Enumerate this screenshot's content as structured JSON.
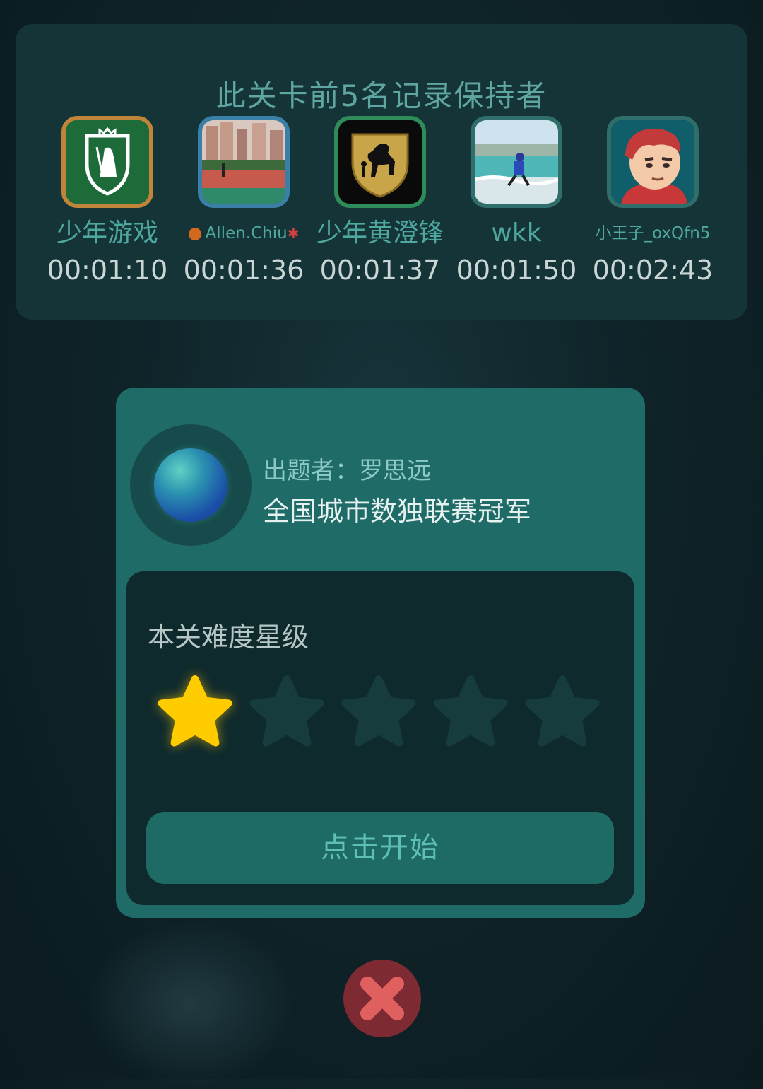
{
  "leaderboard": {
    "title": "此关卡前5名记录保持者",
    "holders": [
      {
        "name": "少年游戏",
        "time": "00:01:10",
        "avatar": "shield-warrior-icon",
        "border": "#c0853a"
      },
      {
        "name": "Allen.Chiu",
        "time": "00:01:36",
        "avatar": "city-court-photo",
        "border": "#3a7fa8"
      },
      {
        "name": "少年黄澄锋",
        "time": "00:01:37",
        "avatar": "horse-badge-icon",
        "border": "#2f8c5a"
      },
      {
        "name": "wkk",
        "time": "00:01:50",
        "avatar": "beach-photo",
        "border": "#2f6e6b"
      },
      {
        "name": "小王子_oxQfn5",
        "time": "00:02:43",
        "avatar": "cartoon-boy-icon",
        "border": "#2f6e6b"
      }
    ]
  },
  "level": {
    "author": "出题者：罗思远",
    "author_title": "全国城市数独联赛冠军",
    "difficulty_label": "本关难度星级",
    "difficulty_stars": 1,
    "difficulty_max": 5,
    "start_label": "点击开始"
  },
  "colors": {
    "star_on": "#ffcc00",
    "star_off": "#173c3d",
    "close": "#e06060"
  }
}
